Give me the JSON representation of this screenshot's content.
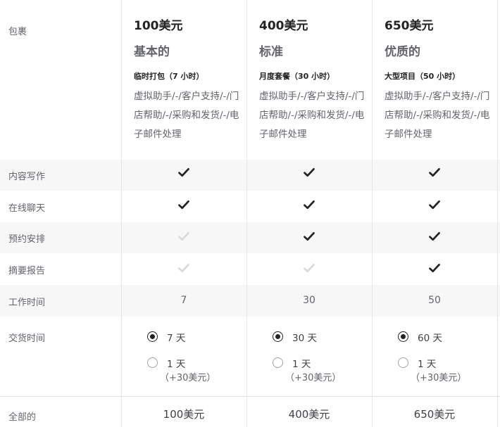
{
  "row_labels": {
    "package": "包裹",
    "content_writing": "内容写作",
    "live_chat": "在线聊天",
    "appointment": "预约安排",
    "summary_report": "摘要报告",
    "work_hours": "工作时间",
    "delivery_time": "交货时间",
    "total": "全部的"
  },
  "packages": [
    {
      "price": "100美元",
      "tier": "基本的",
      "subtitle": "临时打包（7 小时）",
      "description": "虚拟助手/-/客户支持/-/门店帮助/-/采购和发货/-/电子邮件处理",
      "content_writing": true,
      "live_chat": true,
      "appointment": false,
      "summary_report": false,
      "hours": "7",
      "delivery_default": "7 天",
      "delivery_fast": "1 天",
      "delivery_fast_extra": "（+30美元）",
      "total": "100美元"
    },
    {
      "price": "400美元",
      "tier": "标准",
      "subtitle": "月度套餐（30 小时）",
      "description": "虚拟助手/-/客户支持/-/门店帮助/-/采购和发货/-/电子邮件处理",
      "content_writing": true,
      "live_chat": true,
      "appointment": true,
      "summary_report": false,
      "hours": "30",
      "delivery_default": "30 天",
      "delivery_fast": "1 天",
      "delivery_fast_extra": "（+30美元）",
      "total": "400美元"
    },
    {
      "price": "650美元",
      "tier": "优质的",
      "subtitle": "大型项目（50 小时）",
      "description": "虚拟助手/-/客户支持/-/门店帮助/-/采购和发货/-/电子邮件处理",
      "content_writing": true,
      "live_chat": true,
      "appointment": true,
      "summary_report": true,
      "hours": "50",
      "delivery_default": "60 天",
      "delivery_fast": "1 天",
      "delivery_fast_extra": "（+30美元）",
      "total": "650美元"
    }
  ],
  "colors": {
    "check_on": "#222325",
    "check_off": "#d9d9d9",
    "shade": "#f7f7f7",
    "border": "#e6e6e6"
  },
  "icons": {
    "check": "check-icon",
    "radio": "radio-button"
  }
}
